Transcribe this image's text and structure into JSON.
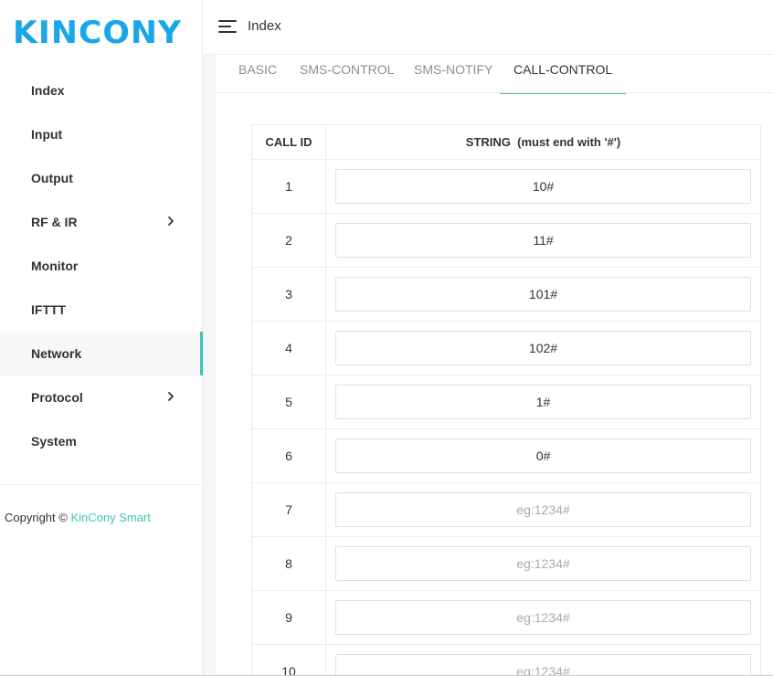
{
  "brand": {
    "logo": "KINCONY",
    "color": "#1aa7e8"
  },
  "sidebar": {
    "items": [
      {
        "label": "Index",
        "has_children": false,
        "active": false
      },
      {
        "label": "Input",
        "has_children": false,
        "active": false
      },
      {
        "label": "Output",
        "has_children": false,
        "active": false
      },
      {
        "label": "RF & IR",
        "has_children": true,
        "active": false
      },
      {
        "label": "Monitor",
        "has_children": false,
        "active": false
      },
      {
        "label": "IFTTT",
        "has_children": false,
        "active": false
      },
      {
        "label": "Network",
        "has_children": false,
        "active": true
      },
      {
        "label": "Protocol",
        "has_children": true,
        "active": false
      },
      {
        "label": "System",
        "has_children": false,
        "active": false
      }
    ],
    "copyright_prefix": "Copyright © ",
    "copyright_brand": "KinCony Smart"
  },
  "header": {
    "title": "Index",
    "menu_icon": "hamburger-menu-icon"
  },
  "tabs": [
    {
      "label": "BASIC",
      "active": false
    },
    {
      "label": "SMS-CONTROL",
      "active": false
    },
    {
      "label": "SMS-NOTIFY",
      "active": false
    },
    {
      "label": "CALL-CONTROL",
      "active": true
    }
  ],
  "table": {
    "headers": {
      "id": "CALL ID",
      "string": "STRING  (must end with '#')"
    },
    "placeholder": "eg:1234#",
    "rows": [
      {
        "id": "1",
        "value": "10#"
      },
      {
        "id": "2",
        "value": "11#"
      },
      {
        "id": "3",
        "value": "101#"
      },
      {
        "id": "4",
        "value": "102#"
      },
      {
        "id": "5",
        "value": "1#"
      },
      {
        "id": "6",
        "value": "0#"
      },
      {
        "id": "7",
        "value": ""
      },
      {
        "id": "8",
        "value": ""
      },
      {
        "id": "9",
        "value": ""
      },
      {
        "id": "10",
        "value": ""
      }
    ]
  },
  "colors": {
    "accent": "#3ec4b0",
    "logo": "#1aa7e8"
  }
}
